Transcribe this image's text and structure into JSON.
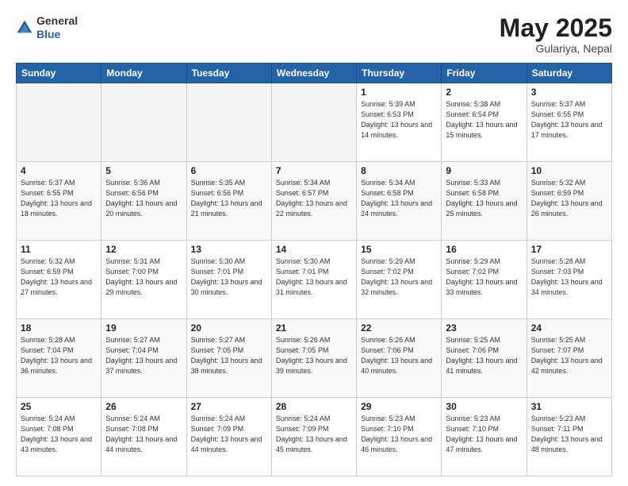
{
  "header": {
    "logo": {
      "general": "General",
      "blue": "Blue"
    },
    "title": "May 2025",
    "location": "Gulariya, Nepal"
  },
  "days_of_week": [
    "Sunday",
    "Monday",
    "Tuesday",
    "Wednesday",
    "Thursday",
    "Friday",
    "Saturday"
  ],
  "weeks": [
    [
      {
        "day": "",
        "sunrise": "",
        "sunset": "",
        "daylight": "",
        "empty": true
      },
      {
        "day": "",
        "sunrise": "",
        "sunset": "",
        "daylight": "",
        "empty": true
      },
      {
        "day": "",
        "sunrise": "",
        "sunset": "",
        "daylight": "",
        "empty": true
      },
      {
        "day": "",
        "sunrise": "",
        "sunset": "",
        "daylight": "",
        "empty": true
      },
      {
        "day": "1",
        "sunrise": "5:39 AM",
        "sunset": "6:53 PM",
        "daylight": "13 hours and 14 minutes."
      },
      {
        "day": "2",
        "sunrise": "5:38 AM",
        "sunset": "6:54 PM",
        "daylight": "13 hours and 15 minutes."
      },
      {
        "day": "3",
        "sunrise": "5:37 AM",
        "sunset": "6:55 PM",
        "daylight": "13 hours and 17 minutes."
      }
    ],
    [
      {
        "day": "4",
        "sunrise": "5:37 AM",
        "sunset": "6:55 PM",
        "daylight": "13 hours and 18 minutes."
      },
      {
        "day": "5",
        "sunrise": "5:36 AM",
        "sunset": "6:56 PM",
        "daylight": "13 hours and 20 minutes."
      },
      {
        "day": "6",
        "sunrise": "5:35 AM",
        "sunset": "6:56 PM",
        "daylight": "13 hours and 21 minutes."
      },
      {
        "day": "7",
        "sunrise": "5:34 AM",
        "sunset": "6:57 PM",
        "daylight": "13 hours and 22 minutes."
      },
      {
        "day": "8",
        "sunrise": "5:34 AM",
        "sunset": "6:58 PM",
        "daylight": "13 hours and 24 minutes."
      },
      {
        "day": "9",
        "sunrise": "5:33 AM",
        "sunset": "6:58 PM",
        "daylight": "13 hours and 25 minutes."
      },
      {
        "day": "10",
        "sunrise": "5:32 AM",
        "sunset": "6:59 PM",
        "daylight": "13 hours and 26 minutes."
      }
    ],
    [
      {
        "day": "11",
        "sunrise": "5:32 AM",
        "sunset": "6:59 PM",
        "daylight": "13 hours and 27 minutes."
      },
      {
        "day": "12",
        "sunrise": "5:31 AM",
        "sunset": "7:00 PM",
        "daylight": "13 hours and 29 minutes."
      },
      {
        "day": "13",
        "sunrise": "5:30 AM",
        "sunset": "7:01 PM",
        "daylight": "13 hours and 30 minutes."
      },
      {
        "day": "14",
        "sunrise": "5:30 AM",
        "sunset": "7:01 PM",
        "daylight": "13 hours and 31 minutes."
      },
      {
        "day": "15",
        "sunrise": "5:29 AM",
        "sunset": "7:02 PM",
        "daylight": "13 hours and 32 minutes."
      },
      {
        "day": "16",
        "sunrise": "5:29 AM",
        "sunset": "7:02 PM",
        "daylight": "13 hours and 33 minutes."
      },
      {
        "day": "17",
        "sunrise": "5:28 AM",
        "sunset": "7:03 PM",
        "daylight": "13 hours and 34 minutes."
      }
    ],
    [
      {
        "day": "18",
        "sunrise": "5:28 AM",
        "sunset": "7:04 PM",
        "daylight": "13 hours and 36 minutes."
      },
      {
        "day": "19",
        "sunrise": "5:27 AM",
        "sunset": "7:04 PM",
        "daylight": "13 hours and 37 minutes."
      },
      {
        "day": "20",
        "sunrise": "5:27 AM",
        "sunset": "7:05 PM",
        "daylight": "13 hours and 38 minutes."
      },
      {
        "day": "21",
        "sunrise": "5:26 AM",
        "sunset": "7:05 PM",
        "daylight": "13 hours and 39 minutes."
      },
      {
        "day": "22",
        "sunrise": "5:26 AM",
        "sunset": "7:06 PM",
        "daylight": "13 hours and 40 minutes."
      },
      {
        "day": "23",
        "sunrise": "5:25 AM",
        "sunset": "7:06 PM",
        "daylight": "13 hours and 41 minutes."
      },
      {
        "day": "24",
        "sunrise": "5:25 AM",
        "sunset": "7:07 PM",
        "daylight": "13 hours and 42 minutes."
      }
    ],
    [
      {
        "day": "25",
        "sunrise": "5:24 AM",
        "sunset": "7:08 PM",
        "daylight": "13 hours and 43 minutes."
      },
      {
        "day": "26",
        "sunrise": "5:24 AM",
        "sunset": "7:08 PM",
        "daylight": "13 hours and 44 minutes."
      },
      {
        "day": "27",
        "sunrise": "5:24 AM",
        "sunset": "7:09 PM",
        "daylight": "13 hours and 44 minutes."
      },
      {
        "day": "28",
        "sunrise": "5:24 AM",
        "sunset": "7:09 PM",
        "daylight": "13 hours and 45 minutes."
      },
      {
        "day": "29",
        "sunrise": "5:23 AM",
        "sunset": "7:10 PM",
        "daylight": "13 hours and 46 minutes."
      },
      {
        "day": "30",
        "sunrise": "5:23 AM",
        "sunset": "7:10 PM",
        "daylight": "13 hours and 47 minutes."
      },
      {
        "day": "31",
        "sunrise": "5:23 AM",
        "sunset": "7:11 PM",
        "daylight": "13 hours and 48 minutes."
      }
    ]
  ]
}
